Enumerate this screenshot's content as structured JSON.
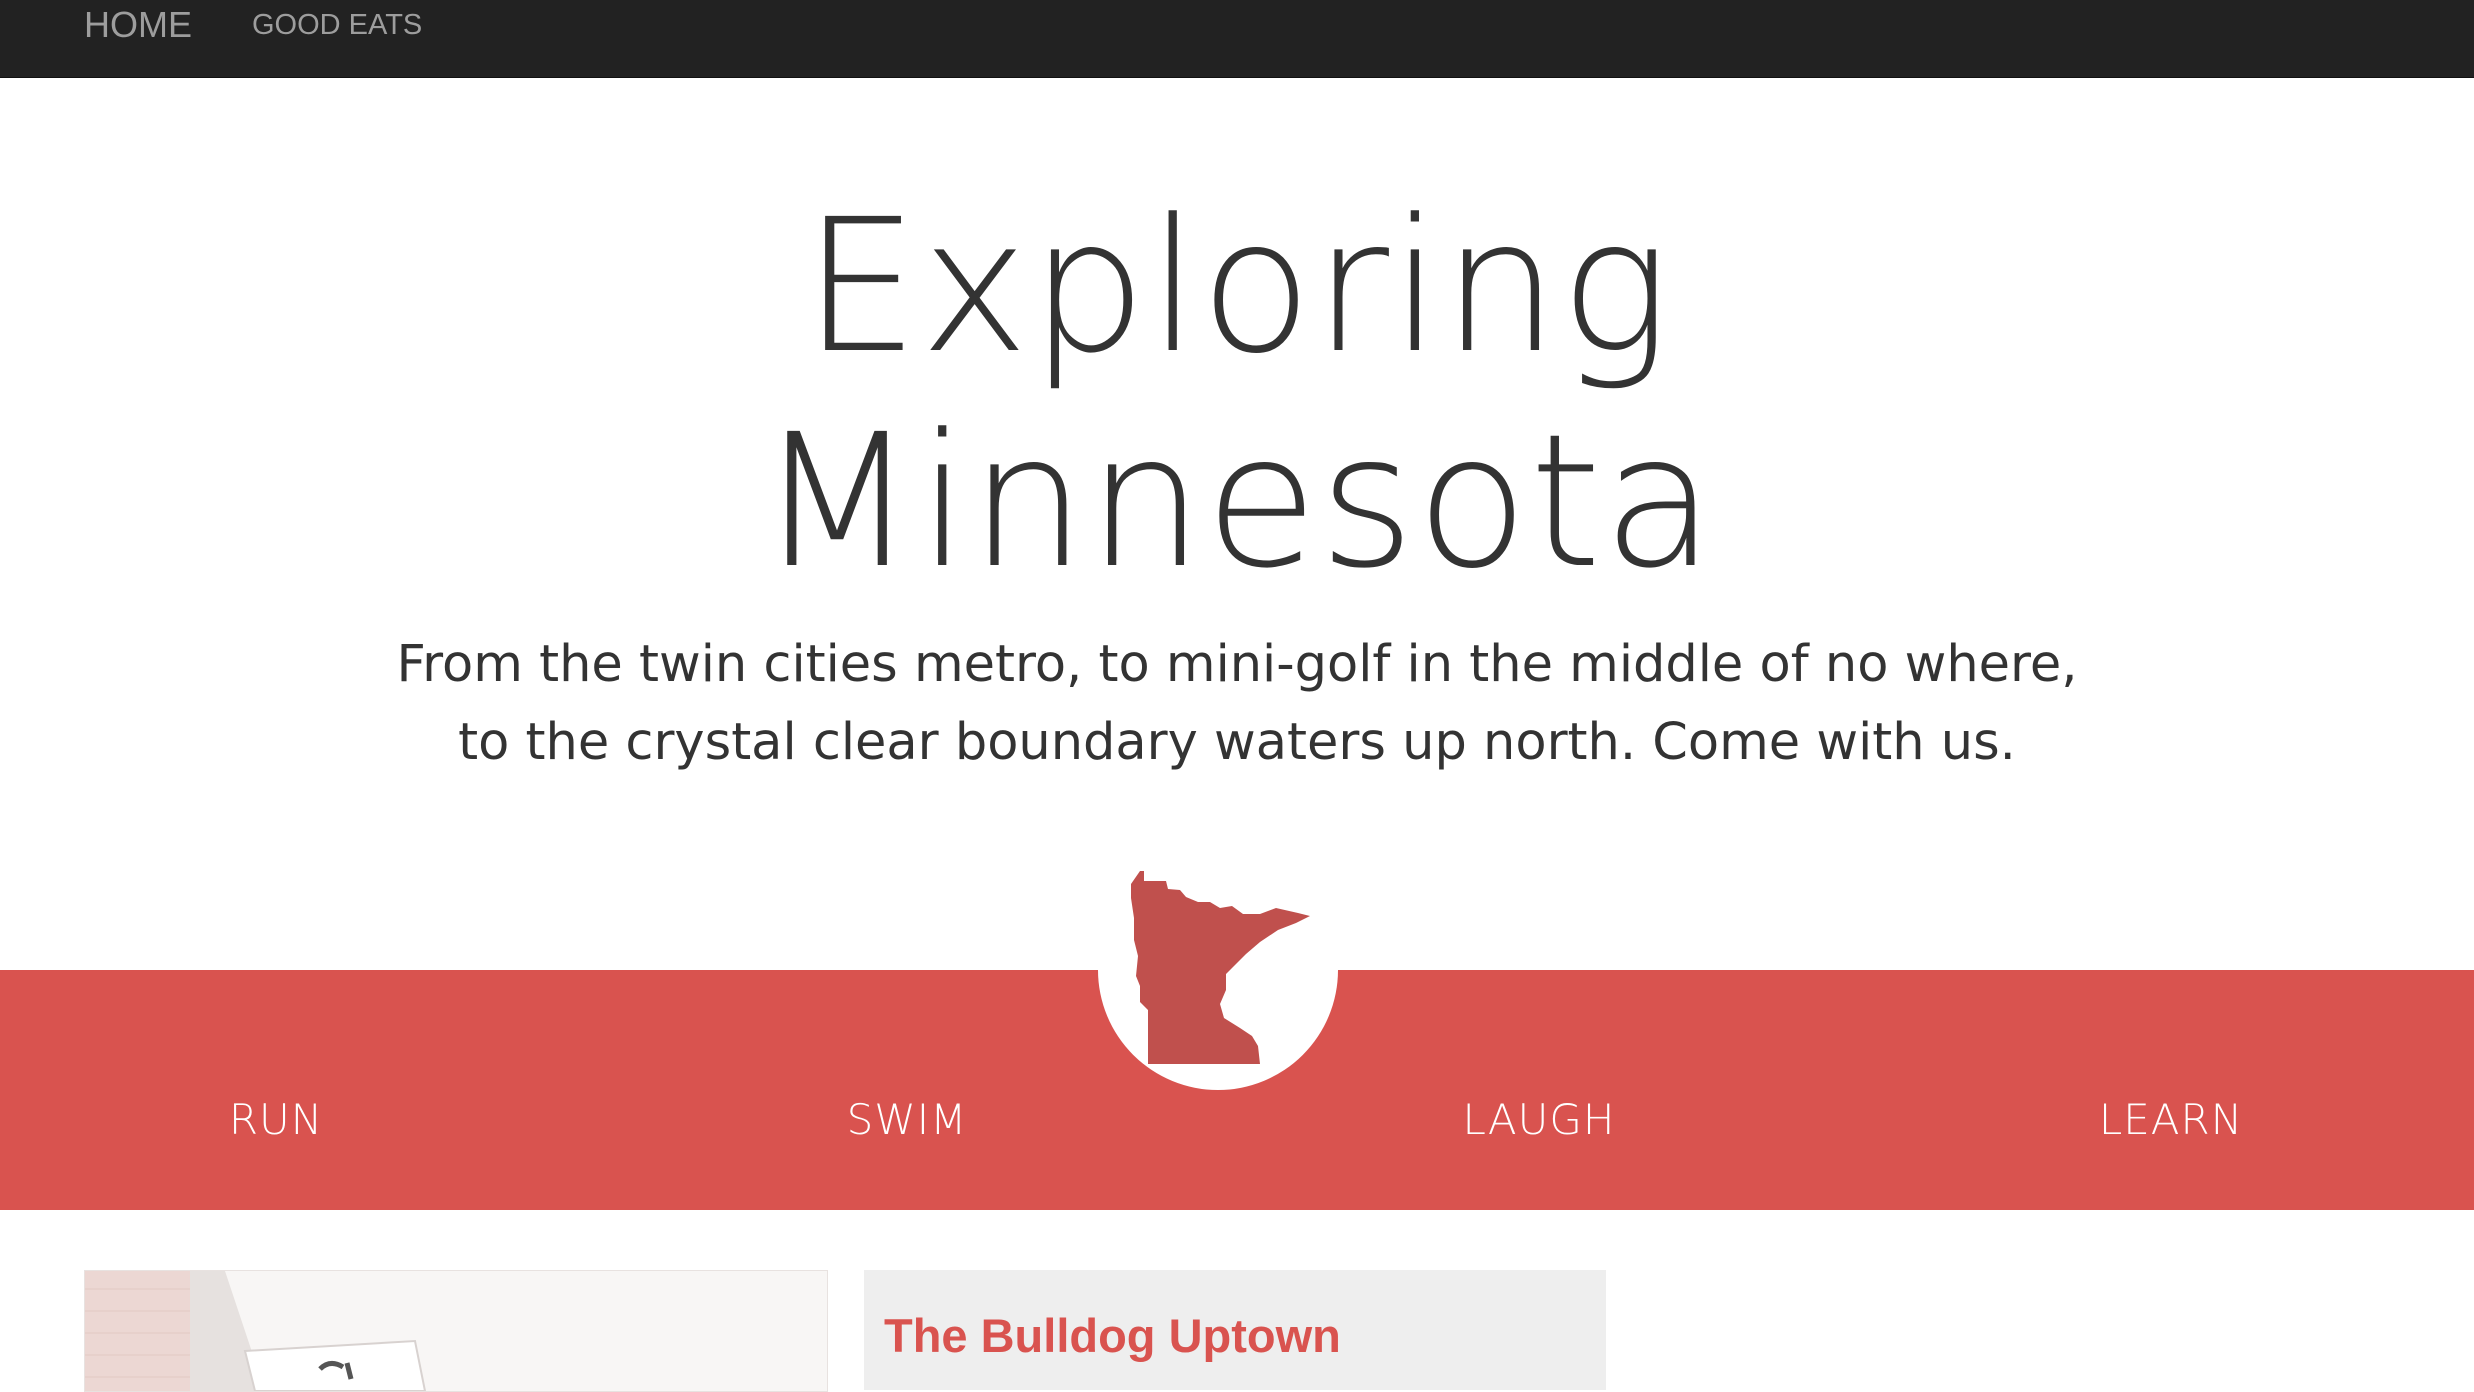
{
  "nav": {
    "items": [
      {
        "label": "HOME"
      },
      {
        "label": "GOOD EATS"
      }
    ]
  },
  "hero": {
    "title_line1": "Exploring",
    "title_line2": "Minnesota",
    "subtitle_line1": "From the twin cities metro, to mini-golf in the middle of no where,",
    "subtitle_line2": "to the crystal clear boundary waters up north. Come with us."
  },
  "activities": [
    {
      "label": "RUN"
    },
    {
      "label": "SWIM"
    },
    {
      "label": "LAUGH"
    },
    {
      "label": "LEARN"
    }
  ],
  "cards": [
    {
      "title": ""
    },
    {
      "title": "The Bulldog Uptown"
    }
  ],
  "colors": {
    "accent": "#d9534f",
    "state_fill": "#c0504d",
    "navbar": "#222222",
    "text": "#333333"
  },
  "icons": {
    "state_logo": "minnesota-state-icon"
  }
}
